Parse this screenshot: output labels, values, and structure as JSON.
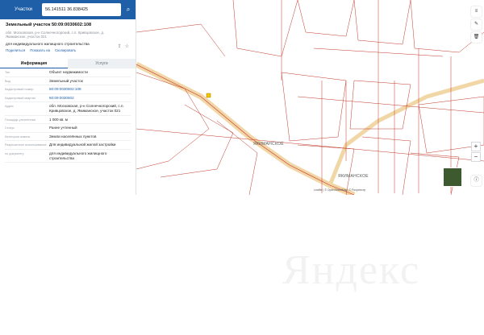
{
  "search": {
    "selector": "Участки",
    "query": "56.141511 36.838425"
  },
  "object": {
    "title": "Земельный участок 50:09:0030602:108",
    "address": "обл. Московская, р-н Солнечногорский, с.п. Кривцовское, д. Якиманское, участок 021",
    "use": "для индивидуального жилищного строительства",
    "links": [
      "Поделиться",
      "Показать на",
      "Скопировать"
    ]
  },
  "tabs": [
    "Информация",
    "Услуги"
  ],
  "props": [
    {
      "k": "Тип",
      "v": "Объект недвижимости"
    },
    {
      "k": "Вид",
      "v": "Земельный участок"
    },
    {
      "k": "Кадастровый номер",
      "v": "50:09:0030602:108"
    },
    {
      "k": "Кадастровый квартал",
      "v": "50:09:0030602"
    },
    {
      "k": "Адрес",
      "v": "обл. Московская, р-н Солнечногорский, с.п. Кривцовское, д. Якиманское, участок 021"
    },
    {
      "k": "Площадь уточненная",
      "v": "1 000 кв. м"
    },
    {
      "k": "Статус",
      "v": "Ранее учтенный"
    },
    {
      "k": "Категория земель",
      "v": "Земли населённых пунктов"
    },
    {
      "k": "Разрешенное использование",
      "v": "Для индивидуальной жилой застройки"
    },
    {
      "k": "по документу",
      "v": "для индивидуального жилищного строительства"
    }
  ],
  "map": {
    "village": "ЯКИМАНСКОЕ",
    "village2": "ЯКИМАНСКОЕ",
    "attribution": "Leaflet | © OpenStreetMap, © Росреестр",
    "watermark": "Яндекс"
  }
}
